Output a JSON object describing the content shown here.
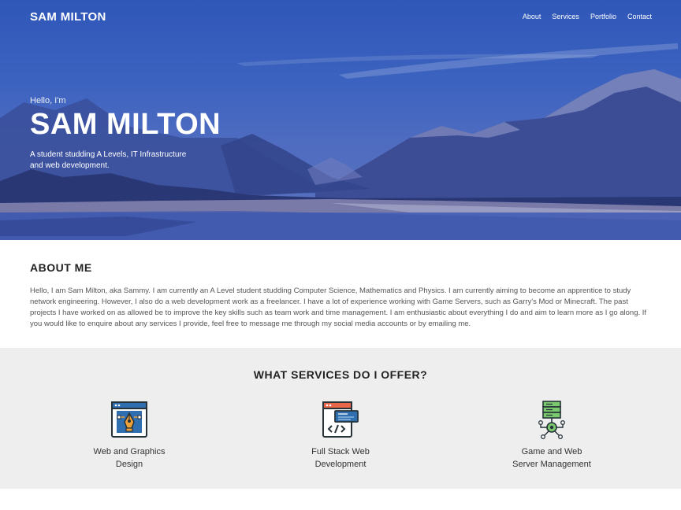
{
  "nav": {
    "brand": "SAM MILTON",
    "links": [
      "About",
      "Services",
      "Portfolio",
      "Contact"
    ]
  },
  "hero": {
    "greeting": "Hello, I'm",
    "title": "SAM MILTON",
    "subtitle_line1": "A student studding A Levels, IT Infrastructure",
    "subtitle_line2": "and web development."
  },
  "about": {
    "heading": "ABOUT ME",
    "body": "Hello, I am Sam Milton, aka Sammy. I am currently an A Level student studding Computer Science, Mathematics and Physics. I am currently aiming to become an apprentice to study network engineering. However, I also do a web development work as a freelancer. I have a lot of experience working with Game Servers, such as Garry's Mod or Minecraft. The past projects I have worked on as allowed be to improve the key skills such as team work and time management. I am enthusiastic about everything I do and aim to learn more as I go along. If you would like to enquire about any services I provide, feel free to message me through my social media accounts or by emailing me."
  },
  "services": {
    "heading": "WHAT SERVICES DO I OFFER?",
    "items": [
      {
        "line1": "Web and Graphics",
        "line2": "Design",
        "icon": "design-tools-icon"
      },
      {
        "line1": "Full Stack Web",
        "line2": "Development",
        "icon": "code-window-icon"
      },
      {
        "line1": "Game and Web",
        "line2": "Server Management",
        "icon": "server-network-icon"
      }
    ]
  },
  "colors": {
    "hero_overlay": "#3d63c0",
    "services_bg": "#eeeeee",
    "icon_blue": "#2f6fb0",
    "icon_orange": "#f0a23a",
    "icon_green": "#7bc96f"
  }
}
